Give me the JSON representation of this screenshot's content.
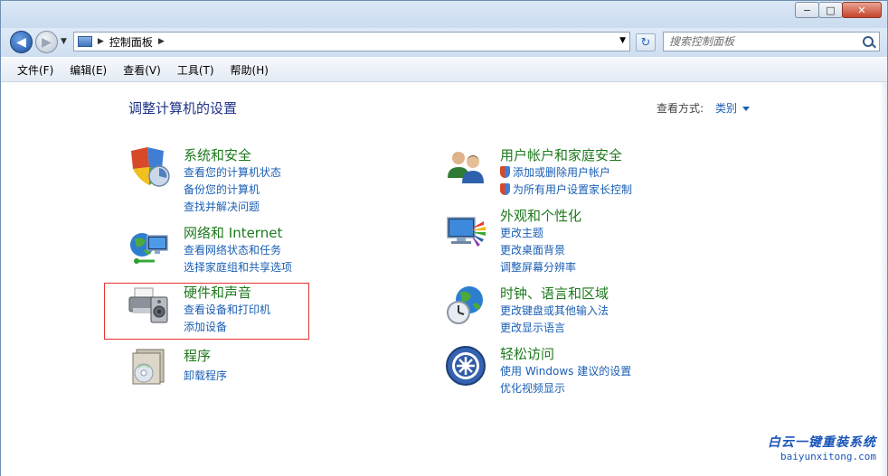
{
  "window": {
    "controls": {
      "minimize": "−",
      "maximize": "□",
      "close": "✕"
    }
  },
  "nav": {
    "back_glyph": "◀",
    "forward_glyph": "▶",
    "breadcrumb": "控制面板",
    "refresh_glyph": "↻",
    "search_placeholder": "搜索控制面板"
  },
  "menu": [
    "文件(F)",
    "编辑(E)",
    "查看(V)",
    "工具(T)",
    "帮助(H)"
  ],
  "page_title": "调整计算机的设置",
  "view_by": {
    "label": "查看方式:",
    "value": "类别"
  },
  "categories": [
    {
      "title": "系统和安全",
      "links": [
        "查看您的计算机状态",
        "备份您的计算机",
        "查找并解决问题"
      ]
    },
    {
      "title": "网络和 Internet",
      "links": [
        "查看网络状态和任务",
        "选择家庭组和共享选项"
      ]
    },
    {
      "title": "硬件和声音",
      "links": [
        "查看设备和打印机",
        "添加设备"
      ]
    },
    {
      "title": "程序",
      "links": [
        "卸载程序"
      ]
    },
    {
      "title": "用户帐户和家庭安全",
      "links": [
        "添加或删除用户帐户",
        "为所有用户设置家长控制"
      ]
    },
    {
      "title": "外观和个性化",
      "links": [
        "更改主题",
        "更改桌面背景",
        "调整屏幕分辨率"
      ]
    },
    {
      "title": "时钟、语言和区域",
      "links": [
        "更改键盘或其他输入法",
        "更改显示语言"
      ]
    },
    {
      "title": "轻松访问",
      "links": [
        "使用 Windows 建议的设置",
        "优化视频显示"
      ]
    }
  ],
  "watermark": {
    "cn": "白云一键重装系统",
    "en": "baiyunxitong.com"
  },
  "colors": {
    "title_green": "#1e7a1e",
    "link_blue": "#1a5fb4",
    "heading_blue": "#1e3287",
    "highlight_red": "#e53333"
  }
}
